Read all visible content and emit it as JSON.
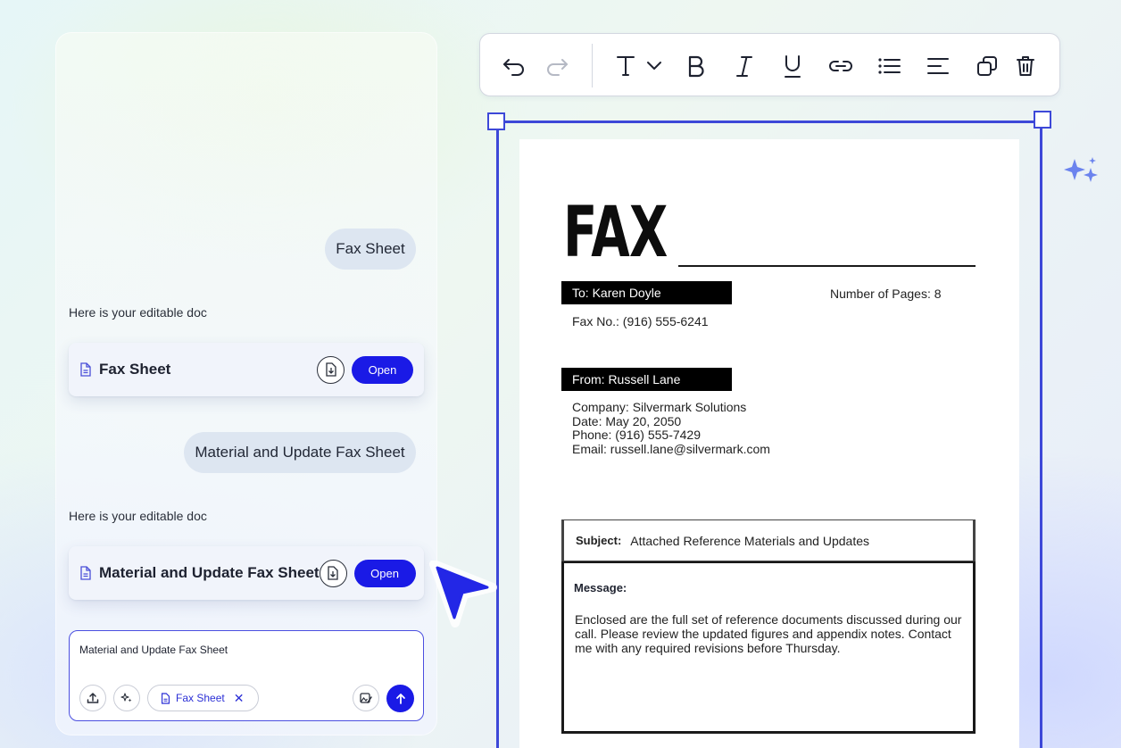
{
  "chat": {
    "messages": [
      {
        "role": "user",
        "text": "Fax Sheet"
      },
      {
        "role": "assistant",
        "text": "Here is your editable doc",
        "doc_title": "Fax Sheet",
        "open_label": "Open"
      },
      {
        "role": "user",
        "text": "Material and Update Fax Sheet"
      },
      {
        "role": "assistant",
        "text": "Here is your editable doc",
        "doc_title": "Material and Update Fax Sheet",
        "open_label": "Open"
      }
    ],
    "composer": {
      "value": "Material and Update Fax Sheet",
      "attachment_chip": "Fax Sheet",
      "chip_remove": "✕"
    }
  },
  "toolbar": {
    "items": [
      "undo-icon",
      "redo-icon",
      "text-style-icon",
      "bold-icon",
      "italic-icon",
      "underline-icon",
      "link-icon",
      "bullet-list-icon",
      "align-left-icon",
      "duplicate-icon",
      "delete-icon"
    ]
  },
  "document": {
    "title": "FAX",
    "to_label": "To: Karen Doyle",
    "pages": "Number of Pages: 8",
    "fax_no": "Fax No.: (916) 555-6241",
    "from_label": "From: Russell Lane",
    "from_lines": [
      "Company: Silvermark Solutions",
      "Date: May 20, 2050",
      "Phone: (916) 555-7429",
      "Email: russell.lane@silvermark.com"
    ],
    "subject_label": "Subject:",
    "subject_value": "Attached Reference Materials and Updates",
    "message_label": "Message:",
    "message_body": "Enclosed are the full set of reference documents discussed during our call. Please review the updated figures and appendix notes. Contact me with any required revisions before Thursday."
  },
  "colors": {
    "accent": "#1a1ae6",
    "selection": "#3d48d8",
    "bubble": "#dde6f1"
  }
}
